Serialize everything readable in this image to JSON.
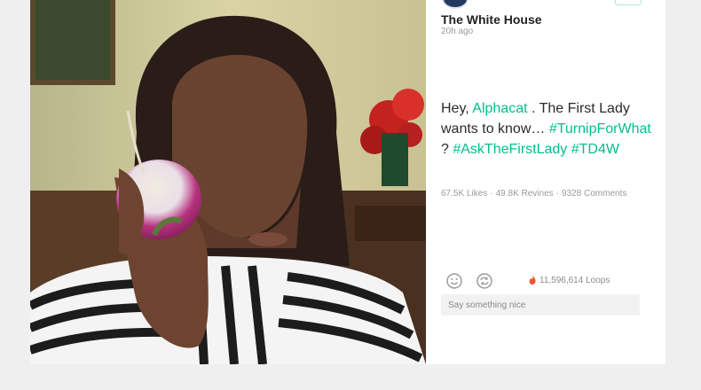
{
  "post": {
    "author": "The White House",
    "time": "20h ago",
    "caption": {
      "greeting": "Hey, ",
      "mention": "Alphacat",
      "after_mention": " . The First Lady wants to know… ",
      "tag1": "#TurnipForWhat",
      "after_tag1": " ? ",
      "tag2": "#AskTheFirstLady",
      "between_tags": " ",
      "tag3": "#TD4W"
    },
    "stats": {
      "likes": "67.5K Likes",
      "revines": "49.8K Revines",
      "comments": "9328 Comments",
      "separator": "·"
    },
    "loops": "11,596,614 Loops",
    "comment_placeholder": "Say something nice"
  },
  "colors": {
    "accent": "#00bf8f",
    "flame": "#f2542d",
    "background": "#efefef"
  },
  "icons": [
    "play-video-icon",
    "smile-icon",
    "revine-icon",
    "flame-icon",
    "more-icon"
  ]
}
